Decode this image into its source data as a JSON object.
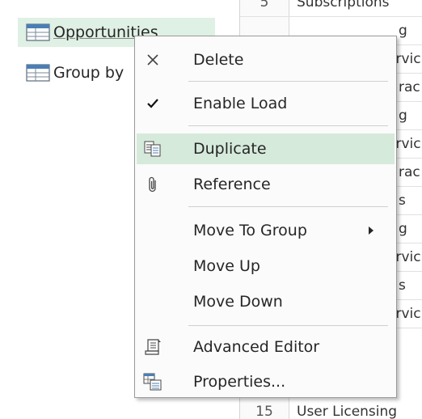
{
  "queries": [
    {
      "label": "Opportunities",
      "selected": true
    },
    {
      "label": "Group by",
      "selected": false
    }
  ],
  "grid": {
    "rows": [
      {
        "num": "5",
        "value": "Subscriptions"
      },
      {
        "num": "",
        "value": "g"
      },
      {
        "num": "",
        "value": "ervic"
      },
      {
        "num": "",
        "value": "rac"
      },
      {
        "num": "",
        "value": "g"
      },
      {
        "num": "",
        "value": "ervic"
      },
      {
        "num": "",
        "value": "rac"
      },
      {
        "num": "",
        "value": "s"
      },
      {
        "num": "",
        "value": "g"
      },
      {
        "num": "",
        "value": "ervic"
      },
      {
        "num": "",
        "value": "s"
      },
      {
        "num": "",
        "value": "ervic"
      },
      {
        "num": "15",
        "value": "User Licensing"
      }
    ]
  },
  "context_menu": {
    "items": [
      {
        "label": "Delete",
        "icon": "delete-x-icon",
        "highlighted": false
      },
      {
        "label": "Enable Load",
        "icon": "checkmark-icon",
        "highlighted": false
      },
      {
        "label": "Duplicate",
        "icon": "duplicate-icon",
        "highlighted": true
      },
      {
        "label": "Reference",
        "icon": "paperclip-icon",
        "highlighted": false
      },
      {
        "label": "Move To Group",
        "icon": "",
        "highlighted": false,
        "submenu": true
      },
      {
        "label": "Move Up",
        "icon": "",
        "highlighted": false
      },
      {
        "label": "Move Down",
        "icon": "",
        "highlighted": false
      },
      {
        "label": "Advanced Editor",
        "icon": "scroll-document-icon",
        "highlighted": false
      },
      {
        "label": "Properties...",
        "icon": "properties-table-icon",
        "highlighted": false
      }
    ]
  },
  "colors": {
    "selection": "#dff0e4",
    "menu_highlight": "#d6eadb",
    "menu_border": "#9a9a9a",
    "text": "#262626",
    "icon_blue": "#4a7fb5"
  }
}
